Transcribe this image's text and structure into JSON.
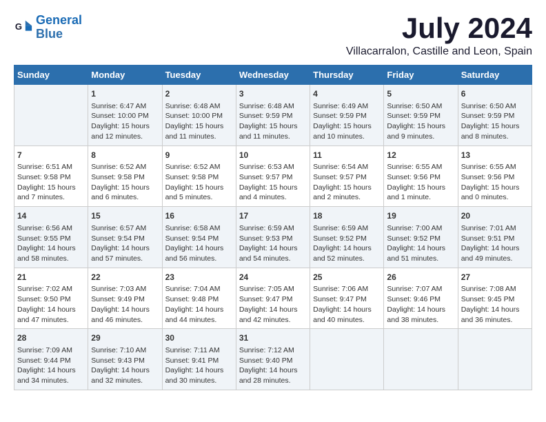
{
  "logo": {
    "line1": "General",
    "line2": "Blue"
  },
  "title": "July 2024",
  "location": "Villacarralon, Castille and Leon, Spain",
  "days_of_week": [
    "Sunday",
    "Monday",
    "Tuesday",
    "Wednesday",
    "Thursday",
    "Friday",
    "Saturday"
  ],
  "weeks": [
    [
      {
        "num": "",
        "info": ""
      },
      {
        "num": "1",
        "info": "Sunrise: 6:47 AM\nSunset: 10:00 PM\nDaylight: 15 hours\nand 12 minutes."
      },
      {
        "num": "2",
        "info": "Sunrise: 6:48 AM\nSunset: 10:00 PM\nDaylight: 15 hours\nand 11 minutes."
      },
      {
        "num": "3",
        "info": "Sunrise: 6:48 AM\nSunset: 9:59 PM\nDaylight: 15 hours\nand 11 minutes."
      },
      {
        "num": "4",
        "info": "Sunrise: 6:49 AM\nSunset: 9:59 PM\nDaylight: 15 hours\nand 10 minutes."
      },
      {
        "num": "5",
        "info": "Sunrise: 6:50 AM\nSunset: 9:59 PM\nDaylight: 15 hours\nand 9 minutes."
      },
      {
        "num": "6",
        "info": "Sunrise: 6:50 AM\nSunset: 9:59 PM\nDaylight: 15 hours\nand 8 minutes."
      }
    ],
    [
      {
        "num": "7",
        "info": "Sunrise: 6:51 AM\nSunset: 9:58 PM\nDaylight: 15 hours\nand 7 minutes."
      },
      {
        "num": "8",
        "info": "Sunrise: 6:52 AM\nSunset: 9:58 PM\nDaylight: 15 hours\nand 6 minutes."
      },
      {
        "num": "9",
        "info": "Sunrise: 6:52 AM\nSunset: 9:58 PM\nDaylight: 15 hours\nand 5 minutes."
      },
      {
        "num": "10",
        "info": "Sunrise: 6:53 AM\nSunset: 9:57 PM\nDaylight: 15 hours\nand 4 minutes."
      },
      {
        "num": "11",
        "info": "Sunrise: 6:54 AM\nSunset: 9:57 PM\nDaylight: 15 hours\nand 2 minutes."
      },
      {
        "num": "12",
        "info": "Sunrise: 6:55 AM\nSunset: 9:56 PM\nDaylight: 15 hours\nand 1 minute."
      },
      {
        "num": "13",
        "info": "Sunrise: 6:55 AM\nSunset: 9:56 PM\nDaylight: 15 hours\nand 0 minutes."
      }
    ],
    [
      {
        "num": "14",
        "info": "Sunrise: 6:56 AM\nSunset: 9:55 PM\nDaylight: 14 hours\nand 58 minutes."
      },
      {
        "num": "15",
        "info": "Sunrise: 6:57 AM\nSunset: 9:54 PM\nDaylight: 14 hours\nand 57 minutes."
      },
      {
        "num": "16",
        "info": "Sunrise: 6:58 AM\nSunset: 9:54 PM\nDaylight: 14 hours\nand 56 minutes."
      },
      {
        "num": "17",
        "info": "Sunrise: 6:59 AM\nSunset: 9:53 PM\nDaylight: 14 hours\nand 54 minutes."
      },
      {
        "num": "18",
        "info": "Sunrise: 6:59 AM\nSunset: 9:52 PM\nDaylight: 14 hours\nand 52 minutes."
      },
      {
        "num": "19",
        "info": "Sunrise: 7:00 AM\nSunset: 9:52 PM\nDaylight: 14 hours\nand 51 minutes."
      },
      {
        "num": "20",
        "info": "Sunrise: 7:01 AM\nSunset: 9:51 PM\nDaylight: 14 hours\nand 49 minutes."
      }
    ],
    [
      {
        "num": "21",
        "info": "Sunrise: 7:02 AM\nSunset: 9:50 PM\nDaylight: 14 hours\nand 47 minutes."
      },
      {
        "num": "22",
        "info": "Sunrise: 7:03 AM\nSunset: 9:49 PM\nDaylight: 14 hours\nand 46 minutes."
      },
      {
        "num": "23",
        "info": "Sunrise: 7:04 AM\nSunset: 9:48 PM\nDaylight: 14 hours\nand 44 minutes."
      },
      {
        "num": "24",
        "info": "Sunrise: 7:05 AM\nSunset: 9:47 PM\nDaylight: 14 hours\nand 42 minutes."
      },
      {
        "num": "25",
        "info": "Sunrise: 7:06 AM\nSunset: 9:47 PM\nDaylight: 14 hours\nand 40 minutes."
      },
      {
        "num": "26",
        "info": "Sunrise: 7:07 AM\nSunset: 9:46 PM\nDaylight: 14 hours\nand 38 minutes."
      },
      {
        "num": "27",
        "info": "Sunrise: 7:08 AM\nSunset: 9:45 PM\nDaylight: 14 hours\nand 36 minutes."
      }
    ],
    [
      {
        "num": "28",
        "info": "Sunrise: 7:09 AM\nSunset: 9:44 PM\nDaylight: 14 hours\nand 34 minutes."
      },
      {
        "num": "29",
        "info": "Sunrise: 7:10 AM\nSunset: 9:43 PM\nDaylight: 14 hours\nand 32 minutes."
      },
      {
        "num": "30",
        "info": "Sunrise: 7:11 AM\nSunset: 9:41 PM\nDaylight: 14 hours\nand 30 minutes."
      },
      {
        "num": "31",
        "info": "Sunrise: 7:12 AM\nSunset: 9:40 PM\nDaylight: 14 hours\nand 28 minutes."
      },
      {
        "num": "",
        "info": ""
      },
      {
        "num": "",
        "info": ""
      },
      {
        "num": "",
        "info": ""
      }
    ]
  ]
}
